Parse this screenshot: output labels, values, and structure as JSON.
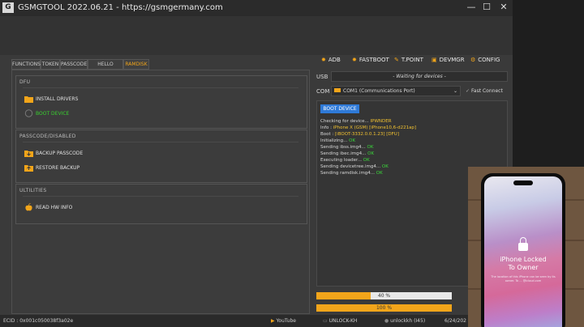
{
  "window": {
    "title": "GSMGTOOL 2022.06.21 - https://gsmgermany.com",
    "logo_text": "G",
    "minimize": "—",
    "maximize": "☐",
    "close": "✕"
  },
  "tabs": [
    {
      "label": "FUNCTIONS"
    },
    {
      "label": "TOKEN"
    },
    {
      "label": "PASSCODE"
    },
    {
      "label": "HELLO SCREEN"
    },
    {
      "label": "RAMDISK",
      "active": true
    }
  ],
  "sections": {
    "dfu": {
      "title": "DFU",
      "install_drivers": "INSTALL DRIVERS",
      "boot_device": "BOOT DEVICE"
    },
    "passcode": {
      "title": "PASSCODE/DISABLED",
      "backup": "BACKUP PASSCODE",
      "restore": "RESTORE BACKUP"
    },
    "utilities": {
      "title": "ULTILITIES",
      "read_hw": "READ HW INFO"
    }
  },
  "toolbar": {
    "adb": "ADB",
    "fastboot": "FASTBOOT",
    "tpoint": "T.POINT",
    "devmgr": "DEVMGR",
    "config": "CONFIG"
  },
  "usb": {
    "label": "USB",
    "value": "- Waiting for devices -"
  },
  "com": {
    "label": "COM",
    "value": "COM1 (Communications Port)",
    "fast_connect": "Fast Connect",
    "check": "✓"
  },
  "log": {
    "button": "BOOT DEVICE",
    "lines": {
      "l1": {
        "text": "Checking for device...",
        "value": "IPWNDER"
      },
      "l2": {
        "text": "Info :",
        "value": "iPhone X (GSM) [iPhone10,6-d221ap]"
      },
      "l3": {
        "text": "Boot :",
        "value": "[iBOOT-3332.0.0.1.23] [DFU]"
      },
      "l4": {
        "text": "Initializing...",
        "value": "OK"
      },
      "l5": {
        "text": "Sending ibss.img4...",
        "value": "OK"
      },
      "l6": {
        "text": "Sending ibec.img4...",
        "value": "OK"
      },
      "l7": {
        "text": "Executing loader...",
        "value": "OK"
      },
      "l8": {
        "text": "Sending devicetree.img4...",
        "value": "OK"
      },
      "l9": {
        "text": "Sending ramdisk.img4...",
        "value": "OK"
      }
    }
  },
  "progress": {
    "bar1": {
      "label": "40 %",
      "value": 40
    },
    "bar2": {
      "label": "100 %",
      "value": 100
    }
  },
  "statusbar": {
    "ecid": "ECID : 0x001c050038f3a02e",
    "youtube": "YouTube",
    "unlock_kh": "UNLOCK-KH",
    "unlockkh": "unlockkh (I45)",
    "date": "6/24/202"
  },
  "phone": {
    "locked_line1": "iPhone Locked",
    "locked_line2": "To Owner",
    "message": "The location of this iPhone can be seen by its owner. To ... @icloud.com"
  },
  "colors": {
    "accent": "#f2a51a",
    "log_value": "#f2c230",
    "ok": "#3ad83a",
    "button_blue": "#2f7ad8"
  }
}
